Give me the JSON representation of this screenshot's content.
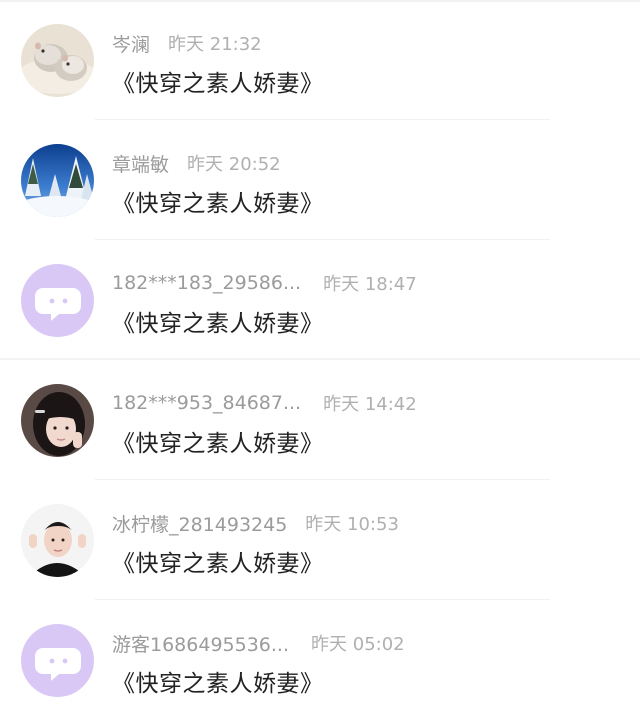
{
  "messages": [
    {
      "name": "岑澜",
      "time": "昨天 21:32",
      "text": "《快穿之素人娇妻》",
      "avatar": "hamster-photo"
    },
    {
      "name": "章端敏",
      "time": "昨天 20:52",
      "text": "《快穿之素人娇妻》",
      "avatar": "snowy-trees-photo"
    },
    {
      "name": "182***183_29586...",
      "time": "昨天 18:47",
      "text": "《快穿之素人娇妻》",
      "avatar": "default-chat-bubble-icon"
    },
    {
      "name": "182***953_84687...",
      "time": "昨天 14:42",
      "text": "《快穿之素人娇妻》",
      "avatar": "girl-portrait-photo"
    },
    {
      "name": "冰柠檬_281493245",
      "time": "昨天 10:53",
      "text": "《快穿之素人娇妻》",
      "avatar": "boy-portrait-photo"
    },
    {
      "name": "游客1686495536...",
      "time": "昨天 05:02",
      "text": "《快穿之素人娇妻》",
      "avatar": "default-chat-bubble-icon"
    }
  ],
  "colors": {
    "default_avatar_bg": "#d9c8f5",
    "default_avatar_icon": "#ffffff",
    "name_text": "#9b9b9b",
    "time_text": "#b0b0b0",
    "message_text": "#222222"
  }
}
